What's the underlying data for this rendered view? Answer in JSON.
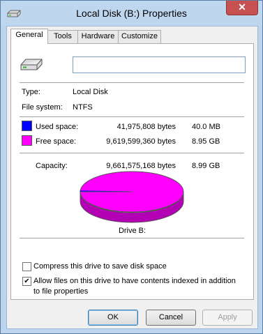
{
  "window": {
    "title": "Local Disk (B:) Properties",
    "close_glyph": "✕"
  },
  "tabs": [
    {
      "label": "General",
      "active": true
    },
    {
      "label": "Tools",
      "active": false
    },
    {
      "label": "Hardware",
      "active": false
    },
    {
      "label": "Customize",
      "active": false
    }
  ],
  "general": {
    "name_value": "",
    "type_label": "Type:",
    "type_value": "Local Disk",
    "fs_label": "File system:",
    "fs_value": "NTFS",
    "used_label": "Used space:",
    "used_bytes": "41,975,808 bytes",
    "used_size": "40.0 MB",
    "free_label": "Free space:",
    "free_bytes": "9,619,599,360 bytes",
    "free_size": "8.95 GB",
    "capacity_label": "Capacity:",
    "capacity_bytes": "9,661,575,168 bytes",
    "capacity_size": "8.99 GB",
    "drive_label": "Drive B:",
    "used_fraction": 0.0043,
    "compress_label": "Compress this drive to save disk space",
    "compress_checked": false,
    "index_label": "Allow files on this drive to have contents indexed in addition to file properties",
    "index_checked": true,
    "check_glyph": "✔"
  },
  "colors": {
    "used": "#0000ff",
    "free": "#ff00ff"
  },
  "buttons": {
    "ok": "OK",
    "cancel": "Cancel",
    "apply": "Apply"
  }
}
